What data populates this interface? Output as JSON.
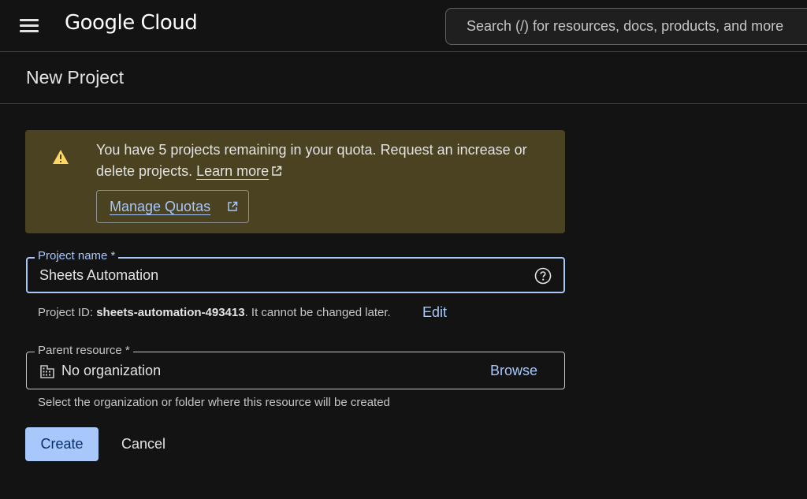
{
  "header": {
    "app_name": "Google Cloud",
    "menu_icon": "hamburger-menu-icon",
    "search_placeholder": "Search (/) for resources, docs, products, and more"
  },
  "page": {
    "title": "New Project"
  },
  "quota_banner": {
    "icon": "warning-icon",
    "message": "You have 5 projects remaining in your quota. Request an increase or delete projects.",
    "learn_more": "Learn more",
    "manage_quotas": "Manage Quotas",
    "background": "#4a4220",
    "icon_color": "#fdd663"
  },
  "project_name": {
    "label": "Project name *",
    "value": "Sheets Automation",
    "help_icon": "help-circle-icon",
    "project_id_prefix": "Project ID: ",
    "project_id": "sheets-automation-493413",
    "project_id_suffix": ". It cannot be changed later.",
    "edit_label": "Edit"
  },
  "parent_resource": {
    "label": "Parent resource *",
    "icon": "organization-building-icon",
    "value": "No organization",
    "browse_label": "Browse",
    "helper": "Select the organization or folder where this resource will be created"
  },
  "actions": {
    "create_label": "Create",
    "cancel_label": "Cancel"
  },
  "colors": {
    "background": "#131314",
    "accent": "#a8c7fa",
    "text": "#e3e3e3"
  }
}
